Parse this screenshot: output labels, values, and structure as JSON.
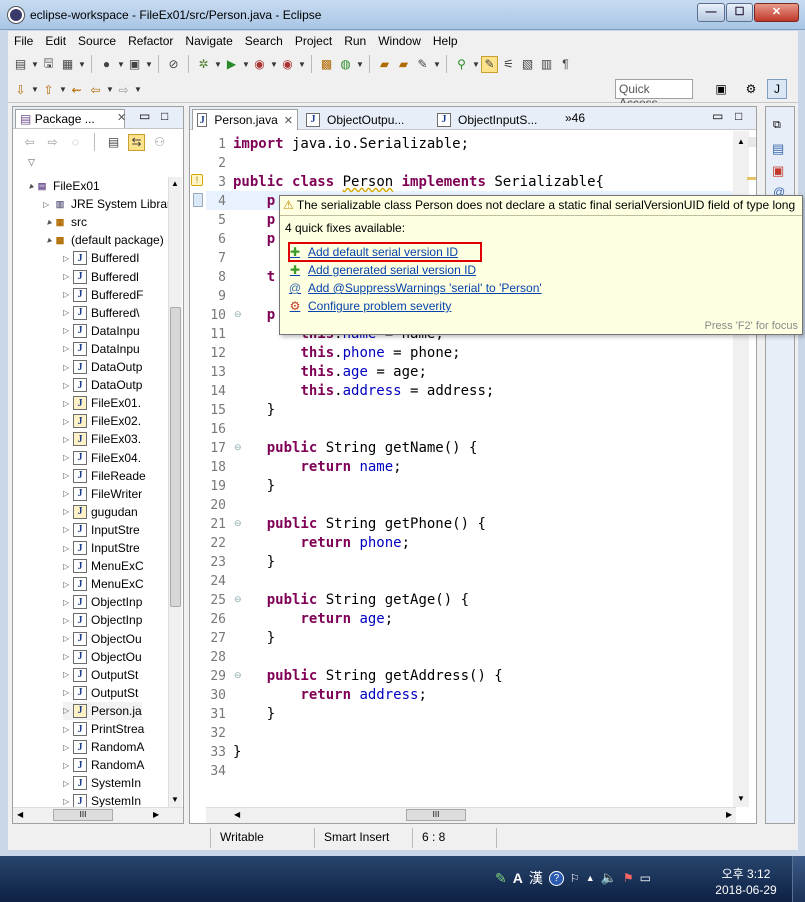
{
  "window": {
    "title": "eclipse-workspace - FileEx01/src/Person.java - Eclipse",
    "min_glyph": "—",
    "max_glyph": "☐",
    "close_glyph": "✕"
  },
  "menu": [
    "File",
    "Edit",
    "Source",
    "Refactor",
    "Navigate",
    "Search",
    "Project",
    "Run",
    "Window",
    "Help"
  ],
  "toolbar": {
    "quick_access": "Quick Access"
  },
  "package_explorer": {
    "tab_label": "Package ...",
    "tree": [
      {
        "label": "FileEx01",
        "kind": "project",
        "indent": 0,
        "twisty": "▲"
      },
      {
        "label": "JRE System Library",
        "kind": "library",
        "indent": 1,
        "twisty": "▷"
      },
      {
        "label": "src",
        "kind": "srcfolder",
        "indent": 1,
        "twisty": "▲"
      },
      {
        "label": "(default package)",
        "kind": "package",
        "indent": 2,
        "twisty": "▲"
      },
      {
        "label": "BufferedI",
        "kind": "java",
        "indent": 3
      },
      {
        "label": "Bufferedl",
        "kind": "java",
        "indent": 3
      },
      {
        "label": "BufferedF",
        "kind": "java",
        "indent": 3
      },
      {
        "label": "Buffered\\",
        "kind": "java",
        "indent": 3
      },
      {
        "label": "DataInpu",
        "kind": "java",
        "indent": 3
      },
      {
        "label": "DataInpu",
        "kind": "java",
        "indent": 3
      },
      {
        "label": "DataOutp",
        "kind": "java",
        "indent": 3
      },
      {
        "label": "DataOutp",
        "kind": "java",
        "indent": 3
      },
      {
        "label": "FileEx01.",
        "kind": "java-run",
        "indent": 3
      },
      {
        "label": "FileEx02.",
        "kind": "java-run",
        "indent": 3
      },
      {
        "label": "FileEx03.",
        "kind": "java-run",
        "indent": 3
      },
      {
        "label": "FileEx04.",
        "kind": "java",
        "indent": 3
      },
      {
        "label": "FileReade",
        "kind": "java",
        "indent": 3
      },
      {
        "label": "FileWriter",
        "kind": "java",
        "indent": 3
      },
      {
        "label": "gugudan",
        "kind": "java-run",
        "indent": 3
      },
      {
        "label": "InputStre",
        "kind": "java",
        "indent": 3
      },
      {
        "label": "InputStre",
        "kind": "java",
        "indent": 3
      },
      {
        "label": "MenuExC",
        "kind": "java",
        "indent": 3
      },
      {
        "label": "MenuExC",
        "kind": "java",
        "indent": 3
      },
      {
        "label": "ObjectInp",
        "kind": "java",
        "indent": 3
      },
      {
        "label": "ObjectInp",
        "kind": "java",
        "indent": 3
      },
      {
        "label": "ObjectOu",
        "kind": "java",
        "indent": 3
      },
      {
        "label": "ObjectOu",
        "kind": "java",
        "indent": 3
      },
      {
        "label": "OutputSt",
        "kind": "java",
        "indent": 3
      },
      {
        "label": "OutputSt",
        "kind": "java",
        "indent": 3
      },
      {
        "label": "Person.ja",
        "kind": "java-run",
        "indent": 3
      },
      {
        "label": "PrintStrea",
        "kind": "java",
        "indent": 3
      },
      {
        "label": "RandomA",
        "kind": "java",
        "indent": 3
      },
      {
        "label": "RandomA",
        "kind": "java",
        "indent": 3
      },
      {
        "label": "SystemIn",
        "kind": "java",
        "indent": 3
      },
      {
        "label": "SystemIn",
        "kind": "java",
        "indent": 3
      }
    ],
    "hscroll_thumb": "III"
  },
  "editor": {
    "tabs": [
      "Person.java",
      "ObjectOutpu...",
      "ObjectInputS..."
    ],
    "overflow": "»46",
    "hscroll_thumb": "III",
    "lines": [
      {
        "n": "1",
        "html": "<span class='kw'>import</span> java.io.Serializable;"
      },
      {
        "n": "2",
        "html": ""
      },
      {
        "n": "3",
        "html": "<span class='kw'>public</span> <span class='kw'>class</span> <span class='warn-ul'>Person</span> <span class='kw'>implements</span> Serializable{"
      },
      {
        "n": "4",
        "html": "    <span class='kw'>p</span>"
      },
      {
        "n": "5",
        "html": "    <span class='kw'>p</span>"
      },
      {
        "n": "6",
        "html": "    <span class='kw'>p</span>"
      },
      {
        "n": "7",
        "html": ""
      },
      {
        "n": "8",
        "html": "    <span class='kw'>t</span>"
      },
      {
        "n": "9",
        "html": ""
      },
      {
        "n": "10",
        "html": "    <span class='kw'>p</span>",
        "fold": true
      },
      {
        "n": "11",
        "html": "        <span class='kw'>this</span>.<span class='fld'>name</span> = name;"
      },
      {
        "n": "12",
        "html": "        <span class='kw'>this</span>.<span class='fld'>phone</span> = phone;"
      },
      {
        "n": "13",
        "html": "        <span class='kw'>this</span>.<span class='fld'>age</span> = age;"
      },
      {
        "n": "14",
        "html": "        <span class='kw'>this</span>.<span class='fld'>address</span> = address;"
      },
      {
        "n": "15",
        "html": "    }"
      },
      {
        "n": "16",
        "html": ""
      },
      {
        "n": "17",
        "html": "    <span class='kw'>public</span> String getName() {",
        "fold": true
      },
      {
        "n": "18",
        "html": "        <span class='kw'>return</span> <span class='fld'>name</span>;"
      },
      {
        "n": "19",
        "html": "    }"
      },
      {
        "n": "20",
        "html": ""
      },
      {
        "n": "21",
        "html": "    <span class='kw'>public</span> String getPhone() {",
        "fold": true
      },
      {
        "n": "22",
        "html": "        <span class='kw'>return</span> <span class='fld'>phone</span>;"
      },
      {
        "n": "23",
        "html": "    }"
      },
      {
        "n": "24",
        "html": ""
      },
      {
        "n": "25",
        "html": "    <span class='kw'>public</span> String getAge() {",
        "fold": true
      },
      {
        "n": "26",
        "html": "        <span class='kw'>return</span> <span class='fld'>age</span>;"
      },
      {
        "n": "27",
        "html": "    }"
      },
      {
        "n": "28",
        "html": ""
      },
      {
        "n": "29",
        "html": "    <span class='kw'>public</span> String getAddress() {",
        "fold": true
      },
      {
        "n": "30",
        "html": "        <span class='kw'>return</span> <span class='fld'>address</span>;"
      },
      {
        "n": "31",
        "html": "    }"
      },
      {
        "n": "32",
        "html": ""
      },
      {
        "n": "33",
        "html": "}"
      },
      {
        "n": "34",
        "html": ""
      }
    ]
  },
  "quick_fix": {
    "header": "The serializable class Person does not declare a static final serialVersionUID field of type long",
    "count": "4 quick fixes available:",
    "items": [
      {
        "label": "Add default serial version ID",
        "icon": "✚",
        "color": "#3c9a2a"
      },
      {
        "label": "Add generated serial version ID",
        "icon": "✚",
        "color": "#3c9a2a"
      },
      {
        "label": "Add @SuppressWarnings 'serial' to 'Person'",
        "icon": "@",
        "color": "#3a6ab0"
      },
      {
        "label": "Configure problem severity",
        "icon": "⚙",
        "color": "#c0392b"
      }
    ],
    "footer": "Press 'F2' for focus"
  },
  "status": {
    "writable": "Writable",
    "insert_mode": "Smart Insert",
    "position": "6 : 8"
  },
  "taskbar": {
    "ime_lang": "A",
    "ime_hanja": "漢",
    "time": "오후 3:12",
    "date": "2018-06-29"
  },
  "colors": {
    "keyword": "#7f0055",
    "field": "#0000c0",
    "selection_box": "#e00000",
    "popup_bg": "#ffffe1"
  }
}
